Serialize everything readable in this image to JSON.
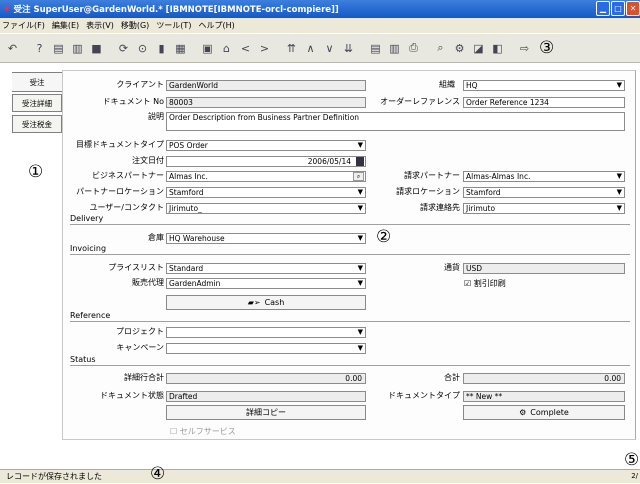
{
  "window": {
    "title": "受注  SuperUser@GardenWorld.* [IBMNOTE[IBMNOTE-orcl-compiere]]"
  },
  "menu": [
    "ファイル(F)",
    "編集(E)",
    "表示(V)",
    "移動(G)",
    "ツール(T)",
    "ヘルプ(H)"
  ],
  "tabs": [
    "受注",
    "受注詳細",
    "受注税金"
  ],
  "form": {
    "client_label": "クライアント",
    "client": "GardenWorld",
    "org_label": "組織",
    "org": "HQ",
    "docno_label": "ドキュメント No",
    "docno": "80003",
    "orderref_label": "オーダーレファレンス",
    "orderref": "Order Reference 1234",
    "desc_label": "説明",
    "desc": "Order Description from Business Partner Definition",
    "targetdoc_label": "目標ドキュメントタイプ",
    "targetdoc": "POS Order",
    "orderdate_label": "注文日付",
    "orderdate": "2006/05/14",
    "bp_label": "ビジネスパートナー",
    "bp": "Almas Inc.",
    "billbp_label": "請求パートナー",
    "billbp": "Almas-Almas Inc.",
    "bploc_label": "パートナーロケーション",
    "bploc": "Stamford",
    "billloc_label": "請求ロケーション",
    "billloc": "Stamford",
    "user_label": "ユーザー/コンタクト",
    "user": "Jirimuto_",
    "billcontact_label": "請求連絡先",
    "billcontact": "Jirimuto",
    "delivery_section": "Delivery",
    "warehouse_label": "倉庫",
    "warehouse": "HQ Warehouse",
    "invoicing_section": "Invoicing",
    "pricelist_label": "プライスリスト",
    "pricelist": "Standard",
    "currency_label": "通貨",
    "currency": "USD",
    "salesrep_label": "販売代理",
    "salesrep": "GardenAdmin",
    "discount_label": "割引印刷",
    "cash_label": "Cash",
    "reference_section": "Reference",
    "project_label": "プロジェクト",
    "campaign_label": "キャンペーン",
    "status_section": "Status",
    "linetotal_label": "詳細行合計",
    "linetotal": "0.00",
    "grandtotal_label": "合計",
    "grandtotal": "0.00",
    "docstatus_label": "ドキュメント状態",
    "docstatus": "Drafted",
    "doctype_label": "ドキュメントタイプ",
    "doctype": "** New **",
    "copy_label": "詳細コピー",
    "complete_label": "Complete",
    "selfservice_label": "セルフサービス"
  },
  "annotations": [
    "①",
    "②",
    "③",
    "④",
    "⑤"
  ],
  "status": {
    "message": "レコードが保存されました",
    "page": "2/"
  }
}
